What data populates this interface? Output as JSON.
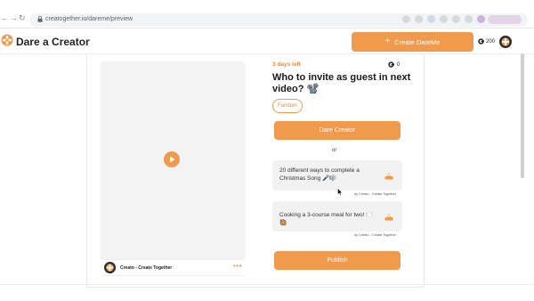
{
  "browser": {
    "url": "creatogether.io/dareme/preview",
    "back_icon": "arrow-left-icon",
    "forward_icon": "arrow-right-icon",
    "reload_icon": "reload-icon"
  },
  "header": {
    "brand": "Dare a Creator",
    "create_button": "Create DareMe",
    "plus_symbol": "+",
    "coins": "200"
  },
  "video": {
    "creator_name": "Creato - Create Together",
    "more_symbol": "•••"
  },
  "dare": {
    "days_left": "3 days left",
    "coins": "0",
    "question": "Who to invite as guest in next video? 📽️",
    "tag": "Fandom",
    "dare_button": "Dare Creator",
    "or_text": "or",
    "options": [
      {
        "text": "20 different ways to complete a Christmas Song 🎤🎼",
        "by": "by Creato - Create Together"
      },
      {
        "text": "Cooking a 3-course meal for two! 🍽️🥘",
        "by": "by Creato - Create Together"
      }
    ],
    "publish_button": "Publish"
  },
  "colors": {
    "accent": "#ef9a4d",
    "accent_text": "#ef8a3a"
  }
}
